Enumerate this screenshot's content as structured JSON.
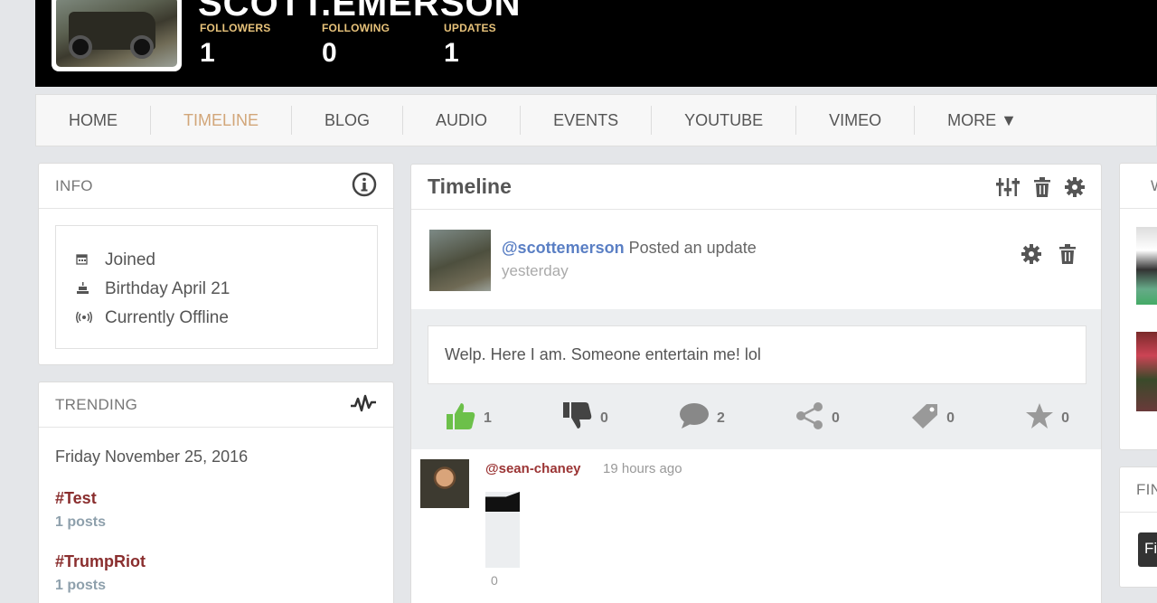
{
  "profile": {
    "name": "SCOTT.EMERSON",
    "stats": [
      {
        "label": "FOLLOWERS",
        "value": "1"
      },
      {
        "label": "FOLLOWING",
        "value": "0"
      },
      {
        "label": "UPDATES",
        "value": "1"
      }
    ]
  },
  "nav": {
    "items": [
      "HOME",
      "TIMELINE",
      "BLOG",
      "AUDIO",
      "EVENTS",
      "YOUTUBE",
      "VIMEO",
      "MORE ▼"
    ],
    "active": "TIMELINE"
  },
  "info": {
    "title": "INFO",
    "rows": [
      {
        "icon": "calendar-icon",
        "text": "Joined"
      },
      {
        "icon": "cake-icon",
        "text": "Birthday April 21"
      },
      {
        "icon": "broadcast-icon",
        "text": "Currently Offline"
      }
    ]
  },
  "trending": {
    "title": "TRENDING",
    "date": "Friday November 25, 2016",
    "tags": [
      {
        "tag": "#Test",
        "count": "1 posts"
      },
      {
        "tag": "#TrumpRiot",
        "count": "1 posts"
      }
    ]
  },
  "timeline": {
    "title": "Timeline",
    "post": {
      "user": "@scottemerson",
      "action": "Posted an update",
      "time": "yesterday",
      "text": "Welp. Here I am. Someone entertain me! lol",
      "reactions": {
        "likes": "1",
        "dislikes": "0",
        "comments": "2",
        "shares": "0",
        "tags": "0",
        "stars": "0"
      }
    },
    "comment": {
      "user": "@sean-chaney",
      "time": "19 hours ago",
      "likes": "0"
    }
  },
  "right": {
    "card1_title": "WH",
    "card2_title": "FIN",
    "button_label": "Fi"
  },
  "colors": {
    "accent_active_nav": "#d2a679",
    "stat_label": "#e7c27a",
    "username_link": "#5a7fc4",
    "hashtag": "#8a2e2e",
    "like_green": "#6cc04a"
  }
}
